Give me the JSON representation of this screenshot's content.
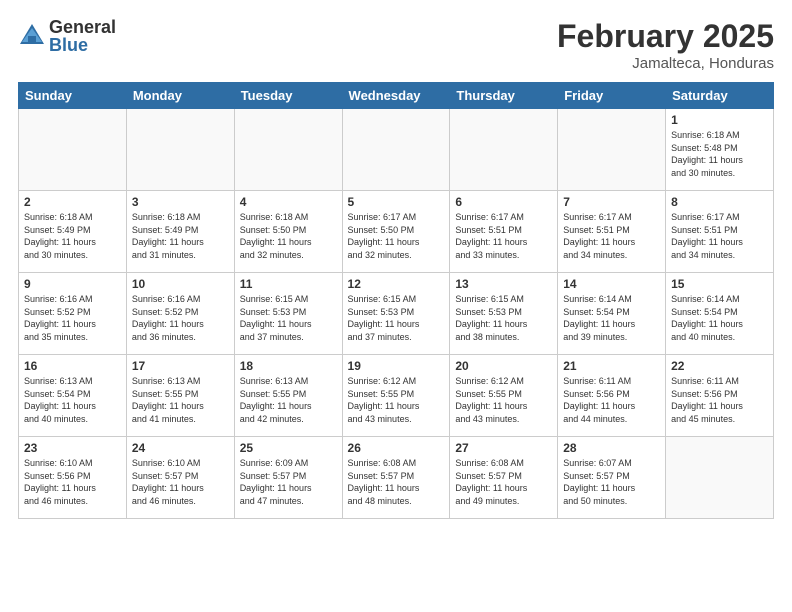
{
  "header": {
    "logo_general": "General",
    "logo_blue": "Blue",
    "month_title": "February 2025",
    "subtitle": "Jamalteca, Honduras"
  },
  "days_of_week": [
    "Sunday",
    "Monday",
    "Tuesday",
    "Wednesday",
    "Thursday",
    "Friday",
    "Saturday"
  ],
  "weeks": [
    [
      {
        "day": "",
        "info": ""
      },
      {
        "day": "",
        "info": ""
      },
      {
        "day": "",
        "info": ""
      },
      {
        "day": "",
        "info": ""
      },
      {
        "day": "",
        "info": ""
      },
      {
        "day": "",
        "info": ""
      },
      {
        "day": "1",
        "info": "Sunrise: 6:18 AM\nSunset: 5:48 PM\nDaylight: 11 hours\nand 30 minutes."
      }
    ],
    [
      {
        "day": "2",
        "info": "Sunrise: 6:18 AM\nSunset: 5:49 PM\nDaylight: 11 hours\nand 30 minutes."
      },
      {
        "day": "3",
        "info": "Sunrise: 6:18 AM\nSunset: 5:49 PM\nDaylight: 11 hours\nand 31 minutes."
      },
      {
        "day": "4",
        "info": "Sunrise: 6:18 AM\nSunset: 5:50 PM\nDaylight: 11 hours\nand 32 minutes."
      },
      {
        "day": "5",
        "info": "Sunrise: 6:17 AM\nSunset: 5:50 PM\nDaylight: 11 hours\nand 32 minutes."
      },
      {
        "day": "6",
        "info": "Sunrise: 6:17 AM\nSunset: 5:51 PM\nDaylight: 11 hours\nand 33 minutes."
      },
      {
        "day": "7",
        "info": "Sunrise: 6:17 AM\nSunset: 5:51 PM\nDaylight: 11 hours\nand 34 minutes."
      },
      {
        "day": "8",
        "info": "Sunrise: 6:17 AM\nSunset: 5:51 PM\nDaylight: 11 hours\nand 34 minutes."
      }
    ],
    [
      {
        "day": "9",
        "info": "Sunrise: 6:16 AM\nSunset: 5:52 PM\nDaylight: 11 hours\nand 35 minutes."
      },
      {
        "day": "10",
        "info": "Sunrise: 6:16 AM\nSunset: 5:52 PM\nDaylight: 11 hours\nand 36 minutes."
      },
      {
        "day": "11",
        "info": "Sunrise: 6:15 AM\nSunset: 5:53 PM\nDaylight: 11 hours\nand 37 minutes."
      },
      {
        "day": "12",
        "info": "Sunrise: 6:15 AM\nSunset: 5:53 PM\nDaylight: 11 hours\nand 37 minutes."
      },
      {
        "day": "13",
        "info": "Sunrise: 6:15 AM\nSunset: 5:53 PM\nDaylight: 11 hours\nand 38 minutes."
      },
      {
        "day": "14",
        "info": "Sunrise: 6:14 AM\nSunset: 5:54 PM\nDaylight: 11 hours\nand 39 minutes."
      },
      {
        "day": "15",
        "info": "Sunrise: 6:14 AM\nSunset: 5:54 PM\nDaylight: 11 hours\nand 40 minutes."
      }
    ],
    [
      {
        "day": "16",
        "info": "Sunrise: 6:13 AM\nSunset: 5:54 PM\nDaylight: 11 hours\nand 40 minutes."
      },
      {
        "day": "17",
        "info": "Sunrise: 6:13 AM\nSunset: 5:55 PM\nDaylight: 11 hours\nand 41 minutes."
      },
      {
        "day": "18",
        "info": "Sunrise: 6:13 AM\nSunset: 5:55 PM\nDaylight: 11 hours\nand 42 minutes."
      },
      {
        "day": "19",
        "info": "Sunrise: 6:12 AM\nSunset: 5:55 PM\nDaylight: 11 hours\nand 43 minutes."
      },
      {
        "day": "20",
        "info": "Sunrise: 6:12 AM\nSunset: 5:55 PM\nDaylight: 11 hours\nand 43 minutes."
      },
      {
        "day": "21",
        "info": "Sunrise: 6:11 AM\nSunset: 5:56 PM\nDaylight: 11 hours\nand 44 minutes."
      },
      {
        "day": "22",
        "info": "Sunrise: 6:11 AM\nSunset: 5:56 PM\nDaylight: 11 hours\nand 45 minutes."
      }
    ],
    [
      {
        "day": "23",
        "info": "Sunrise: 6:10 AM\nSunset: 5:56 PM\nDaylight: 11 hours\nand 46 minutes."
      },
      {
        "day": "24",
        "info": "Sunrise: 6:10 AM\nSunset: 5:57 PM\nDaylight: 11 hours\nand 46 minutes."
      },
      {
        "day": "25",
        "info": "Sunrise: 6:09 AM\nSunset: 5:57 PM\nDaylight: 11 hours\nand 47 minutes."
      },
      {
        "day": "26",
        "info": "Sunrise: 6:08 AM\nSunset: 5:57 PM\nDaylight: 11 hours\nand 48 minutes."
      },
      {
        "day": "27",
        "info": "Sunrise: 6:08 AM\nSunset: 5:57 PM\nDaylight: 11 hours\nand 49 minutes."
      },
      {
        "day": "28",
        "info": "Sunrise: 6:07 AM\nSunset: 5:57 PM\nDaylight: 11 hours\nand 50 minutes."
      },
      {
        "day": "",
        "info": ""
      }
    ]
  ]
}
